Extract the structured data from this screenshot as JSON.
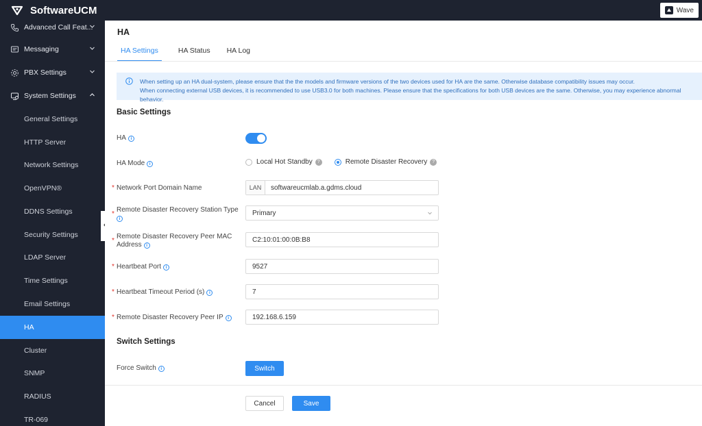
{
  "app": {
    "title": "SoftwareUCM",
    "wave_label": "Wave"
  },
  "sidebar": {
    "items": [
      {
        "label": "Advanced Call Feat...",
        "icon": "phone-settings-icon",
        "type": "parent",
        "expanded": false
      },
      {
        "label": "Messaging",
        "icon": "message-icon",
        "type": "parent",
        "expanded": false
      },
      {
        "label": "PBX Settings",
        "icon": "gear-icon",
        "type": "parent",
        "expanded": false
      },
      {
        "label": "System Settings",
        "icon": "system-icon",
        "type": "parent",
        "expanded": true
      },
      {
        "label": "General Settings",
        "type": "sub"
      },
      {
        "label": "HTTP Server",
        "type": "sub"
      },
      {
        "label": "Network Settings",
        "type": "sub"
      },
      {
        "label": "OpenVPN®",
        "type": "sub"
      },
      {
        "label": "DDNS Settings",
        "type": "sub"
      },
      {
        "label": "Security Settings",
        "type": "sub"
      },
      {
        "label": "LDAP Server",
        "type": "sub"
      },
      {
        "label": "Time Settings",
        "type": "sub"
      },
      {
        "label": "Email Settings",
        "type": "sub"
      },
      {
        "label": "HA",
        "type": "sub",
        "active": true
      },
      {
        "label": "Cluster",
        "type": "sub"
      },
      {
        "label": "SNMP",
        "type": "sub"
      },
      {
        "label": "RADIUS",
        "type": "sub"
      },
      {
        "label": "TR-069",
        "type": "sub"
      }
    ]
  },
  "page": {
    "title": "HA",
    "tabs": [
      {
        "label": "HA Settings",
        "active": true
      },
      {
        "label": "HA Status",
        "active": false
      },
      {
        "label": "HA Log",
        "active": false
      }
    ],
    "notice": {
      "line1": "When setting up an HA dual-system, please ensure that the the models and firmware versions of the two devices used for HA are the same. Otherwise database compatibility issues may occur.",
      "line2": "When connecting external USB devices, it is recommended to use USB3.0 for both machines. Please ensure that the specifications for both USB devices are the same. Otherwise, you may experience abnormal behavior."
    }
  },
  "basic": {
    "title": "Basic Settings",
    "ha_label": "HA",
    "ha_enabled": true,
    "ha_mode_label": "HA Mode",
    "ha_mode_options": [
      "Local Hot Standby",
      "Remote Disaster Recovery"
    ],
    "ha_mode_selected": "Remote Disaster Recovery",
    "domain_label": "Network Port Domain Name",
    "domain_addon": "LAN",
    "domain_value": "softwareucmlab.a.gdms.cloud",
    "station_type_label": "Remote Disaster Recovery Station Type",
    "station_type_value": "Primary",
    "peer_mac_label": "Remote Disaster Recovery Peer MAC Address",
    "peer_mac_value": "C2:10:01:00:0B:B8",
    "heartbeat_port_label": "Heartbeat Port",
    "heartbeat_port_value": "9527",
    "heartbeat_timeout_label": "Heartbeat Timeout Period (s)",
    "heartbeat_timeout_value": "7",
    "peer_ip_label": "Remote Disaster Recovery Peer IP",
    "peer_ip_value": "192.168.6.159"
  },
  "switch": {
    "title": "Switch Settings",
    "force_label": "Force Switch",
    "button_label": "Switch"
  },
  "footer": {
    "cancel_label": "Cancel",
    "save_label": "Save"
  },
  "colors": {
    "accent": "#2f8cf0",
    "sidebar_bg": "#1e2330",
    "notice_bg": "#e6f1fd",
    "required": "#e0322a"
  }
}
